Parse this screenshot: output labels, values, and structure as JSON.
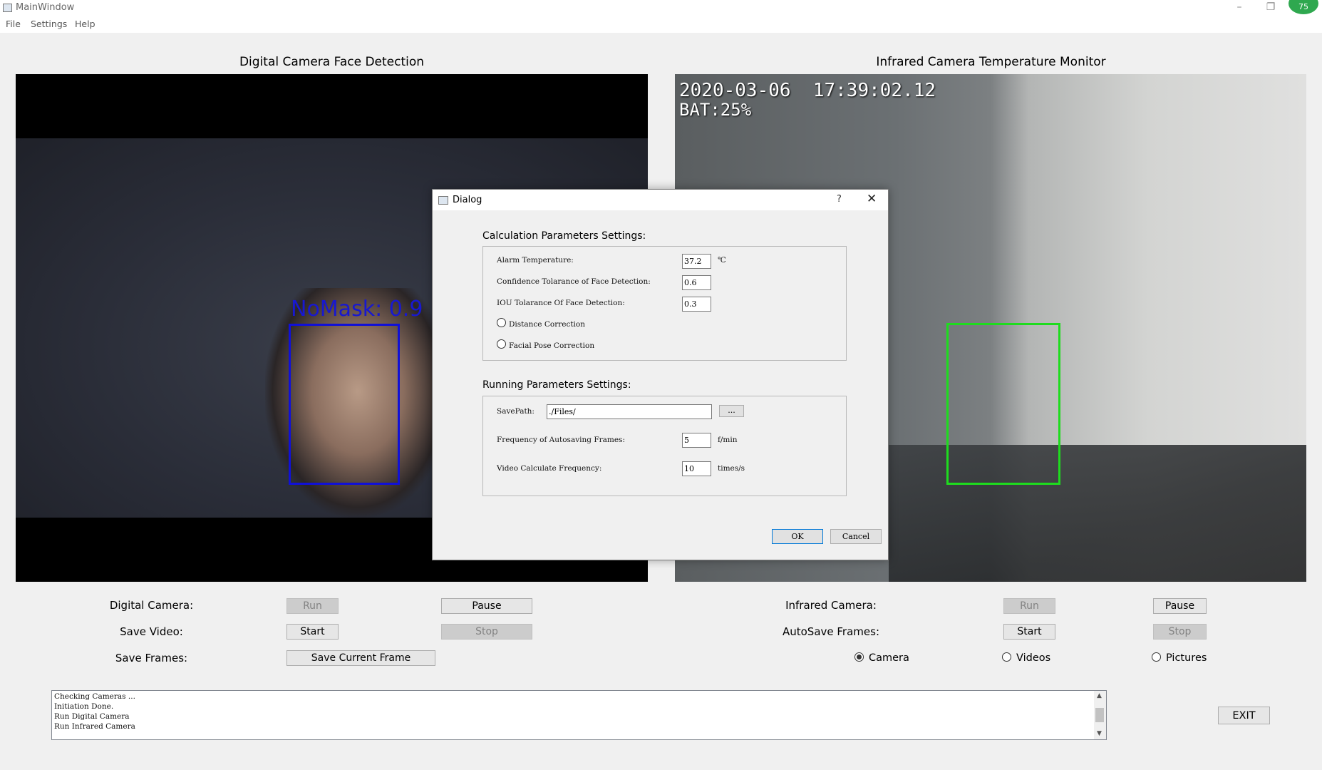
{
  "window": {
    "title": "MainWindow",
    "badge": "75"
  },
  "menu": [
    "File",
    "Settings",
    "Help"
  ],
  "left_panel": {
    "title": "Digital Camera Face Detection",
    "detection_label": "NoMask: 0.9"
  },
  "right_panel": {
    "title": "Infrared Camera Temperature Monitor",
    "timestamp": "2020-03-06  17:39:02.12",
    "battery": "BAT:25%"
  },
  "controls": {
    "digital_camera": {
      "label": "Digital Camera:",
      "run": "Run",
      "pause": "Pause"
    },
    "save_video": {
      "label": "Save Video:",
      "start": "Start",
      "stop": "Stop"
    },
    "save_frames": {
      "label": "Save Frames:",
      "button": "Save Current Frame"
    },
    "infrared_camera": {
      "label": "Infrared Camera:",
      "run": "Run",
      "pause": "Pause"
    },
    "autosave_frames": {
      "label": "AutoSave Frames:",
      "start": "Start",
      "stop": "Stop"
    },
    "source_options": [
      "Camera",
      "Videos",
      "Pictures"
    ],
    "selected_source": "Camera"
  },
  "log": [
    "Checking Cameras ...",
    "Initiation Done.",
    "Run Digital Camera",
    "Run Infrared Camera"
  ],
  "exit_label": "EXIT",
  "dialog": {
    "title": "Dialog",
    "help": "?",
    "calc_group": "Calculation Parameters Settings:",
    "alarm_label": "Alarm Temperature:",
    "alarm_value": "37.2",
    "alarm_unit": "℃",
    "conf_label": "Confidence Tolarance of Face Detection:",
    "conf_value": "0.6",
    "iou_label": "IOU Tolarance Of Face Detection:",
    "iou_value": "0.3",
    "distance_label": "Distance Correction",
    "pose_label": "Facial Pose Correction",
    "run_group": "Running Parameters Settings:",
    "savepath_label": "SavePath:",
    "savepath_value": "./Files/",
    "browse": "...",
    "freq_label": "Frequency of Autosaving Frames:",
    "freq_value": "5",
    "freq_unit": "f/min",
    "video_label": "Video Calculate Frequency:",
    "video_value": "10",
    "video_unit": "times/s",
    "ok": "OK",
    "cancel": "Cancel"
  }
}
